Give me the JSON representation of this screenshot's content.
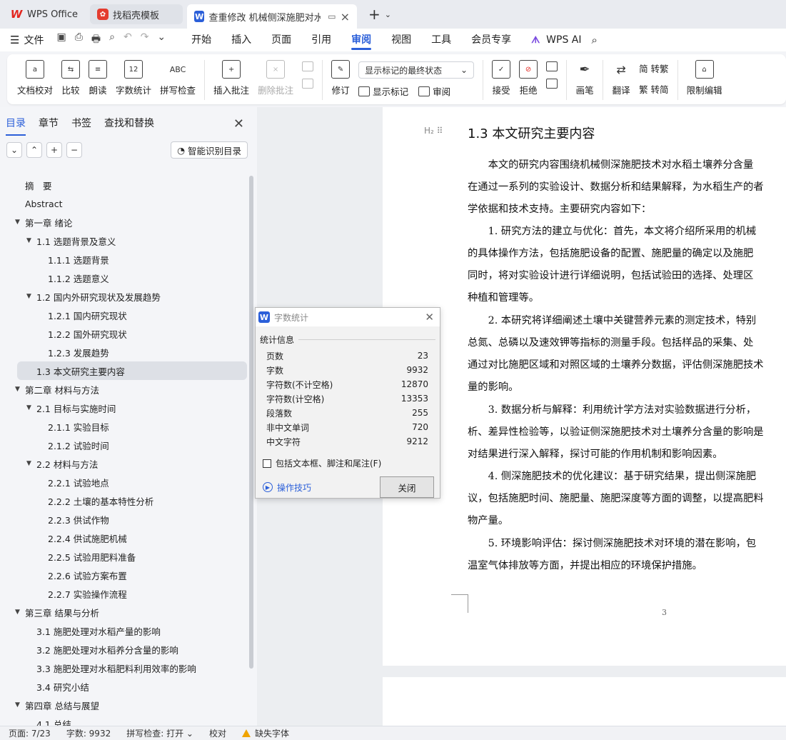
{
  "tabs": [
    {
      "label": "WPS Office"
    },
    {
      "label": "找稻壳模板"
    },
    {
      "label": "查重修改 机械侧深施肥对水稻"
    }
  ],
  "menubar": {
    "file": "文件",
    "items": [
      "开始",
      "插入",
      "页面",
      "引用",
      "审阅",
      "视图",
      "工具",
      "会员专享"
    ],
    "active": "审阅",
    "wps_ai": "WPS AI"
  },
  "ribbon": {
    "doc_check": "文档校对",
    "compare": "比较",
    "read_aloud": "朗读",
    "word_count": "字数统计",
    "spell_check": "拼写检查",
    "insert_comment": "插入批注",
    "delete_comment": "删除批注",
    "track": "修订",
    "markup_dropdown": "显示标记的最终状态",
    "show_markup": "显示标记",
    "review": "审阅",
    "accept": "接受",
    "reject": "拒绝",
    "pen": "画笔",
    "translate": "翻译",
    "to_traditional": "简 转繁",
    "to_simplified": "繁 转简",
    "restrict_edit": "限制编辑"
  },
  "leftpanel": {
    "tabs": [
      "目录",
      "章节",
      "书签",
      "查找和替换"
    ],
    "smart_toc": "智能识别目录",
    "toc": [
      {
        "label": "摘　要",
        "level": 1,
        "arrow": false
      },
      {
        "label": "Abstract",
        "level": 1,
        "arrow": false
      },
      {
        "label": "第一章  绪论",
        "level": 1,
        "arrow": true
      },
      {
        "label": "1.1 选题背景及意义",
        "level": 2,
        "arrow": true
      },
      {
        "label": "1.1.1 选题背景",
        "level": 3,
        "arrow": false
      },
      {
        "label": "1.1.2 选题意义",
        "level": 3,
        "arrow": false
      },
      {
        "label": "1.2  国内外研究现状及发展趋势",
        "level": 2,
        "arrow": true
      },
      {
        "label": "1.2.1  国内研究现状",
        "level": 3,
        "arrow": false
      },
      {
        "label": "1.2.2  国外研究现状",
        "level": 3,
        "arrow": false
      },
      {
        "label": "1.2.3  发展趋势",
        "level": 3,
        "arrow": false
      },
      {
        "label": "1.3  本文研究主要内容",
        "level": 2,
        "arrow": false,
        "selected": true
      },
      {
        "label": "第二章  材料与方法",
        "level": 1,
        "arrow": true
      },
      {
        "label": "2.1  目标与实施时间",
        "level": 2,
        "arrow": true
      },
      {
        "label": "2.1.1  实验目标",
        "level": 3,
        "arrow": false
      },
      {
        "label": "2.1.2  试验时间",
        "level": 3,
        "arrow": false
      },
      {
        "label": "2.2 材料与方法",
        "level": 2,
        "arrow": true
      },
      {
        "label": "2.2.1 试验地点",
        "level": 3,
        "arrow": false
      },
      {
        "label": "2.2.2  土壤的基本特性分析",
        "level": 3,
        "arrow": false
      },
      {
        "label": "2.2.3  供试作物",
        "level": 3,
        "arrow": false
      },
      {
        "label": "2.2.4  供试施肥机械",
        "level": 3,
        "arrow": false
      },
      {
        "label": "2.2.5  试验用肥料准备",
        "level": 3,
        "arrow": false
      },
      {
        "label": "2.2.6  试验方案布置",
        "level": 3,
        "arrow": false
      },
      {
        "label": "2.2.7  实验操作流程",
        "level": 3,
        "arrow": false
      },
      {
        "label": "第三章  结果与分析",
        "level": 1,
        "arrow": true
      },
      {
        "label": "3.1  施肥处理对水稻产量的影响",
        "level": 2,
        "arrow": false
      },
      {
        "label": "3.2  施肥处理对水稻养分含量的影响",
        "level": 2,
        "arrow": false
      },
      {
        "label": "3.3  施肥处理对水稻肥料利用效率的影响",
        "level": 2,
        "arrow": false
      },
      {
        "label": "3.4  研究小结",
        "level": 2,
        "arrow": false
      },
      {
        "label": "第四章  总结与展望",
        "level": 1,
        "arrow": true
      },
      {
        "label": "4.1  总结",
        "level": 2,
        "arrow": false
      }
    ]
  },
  "document": {
    "heading_marker": "H₂",
    "heading": "1.3  本文研究主要内容",
    "lines": [
      "　　本文的研究内容围绕机械侧深施肥技术对水稻土壤养分含量",
      "在通过一系列的实验设计、数据分析和结果解释，为水稻生产的者",
      "学依据和技术支持。主要研究内容如下：",
      "　　1. 研究方法的建立与优化：首先，本文将介绍所采用的机械",
      "的具体操作方法，包括施肥设备的配置、施肥量的确定以及施肥",
      "同时，将对实验设计进行详细说明，包括试验田的选择、处理区",
      "种植和管理等。",
      "　　2. 本研究将详细阐述土壤中关键营养元素的测定技术，特别",
      "总氮、总磷以及速效钾等指标的测量手段。包括样品的采集、处",
      "通过对比施肥区域和对照区域的土壤养分数据，评估侧深施肥技术",
      "量的影响。",
      "　　3. 数据分析与解释：利用统计学方法对实验数据进行分析，",
      "析、差异性检验等，以验证侧深施肥技术对土壤养分含量的影响是",
      "对结果进行深入解释，探讨可能的作用机制和影响因素。",
      "　　4. 侧深施肥技术的优化建议：基于研究结果，提出侧深施肥",
      "议，包括施肥时间、施肥量、施肥深度等方面的调整，以提高肥料",
      "物产量。",
      "　　5. 环境影响评估：探讨侧深施肥技术对环境的潜在影响，包",
      "温室气体排放等方面，并提出相应的环境保护措施。"
    ],
    "page_number": "3"
  },
  "dialog": {
    "title": "字数统计",
    "group": "统计信息",
    "stats": [
      {
        "label": "页数",
        "value": "23"
      },
      {
        "label": "字数",
        "value": "9932"
      },
      {
        "label": "字符数(不计空格)",
        "value": "12870"
      },
      {
        "label": "字符数(计空格)",
        "value": "13353"
      },
      {
        "label": "段落数",
        "value": "255"
      },
      {
        "label": "非中文单词",
        "value": "720"
      },
      {
        "label": "中文字符",
        "value": "9212"
      }
    ],
    "checkbox": "包括文本框、脚注和尾注(F)",
    "tip": "操作技巧",
    "close_btn": "关闭"
  },
  "statusbar": {
    "page": "页面: 7/23",
    "words": "字数: 9932",
    "spell": "拼写检查: 打开",
    "proof": "校对",
    "missing_font": "缺失字体"
  },
  "colors": {
    "accent": "#2b5fd9",
    "wps_red": "#e3261f"
  }
}
